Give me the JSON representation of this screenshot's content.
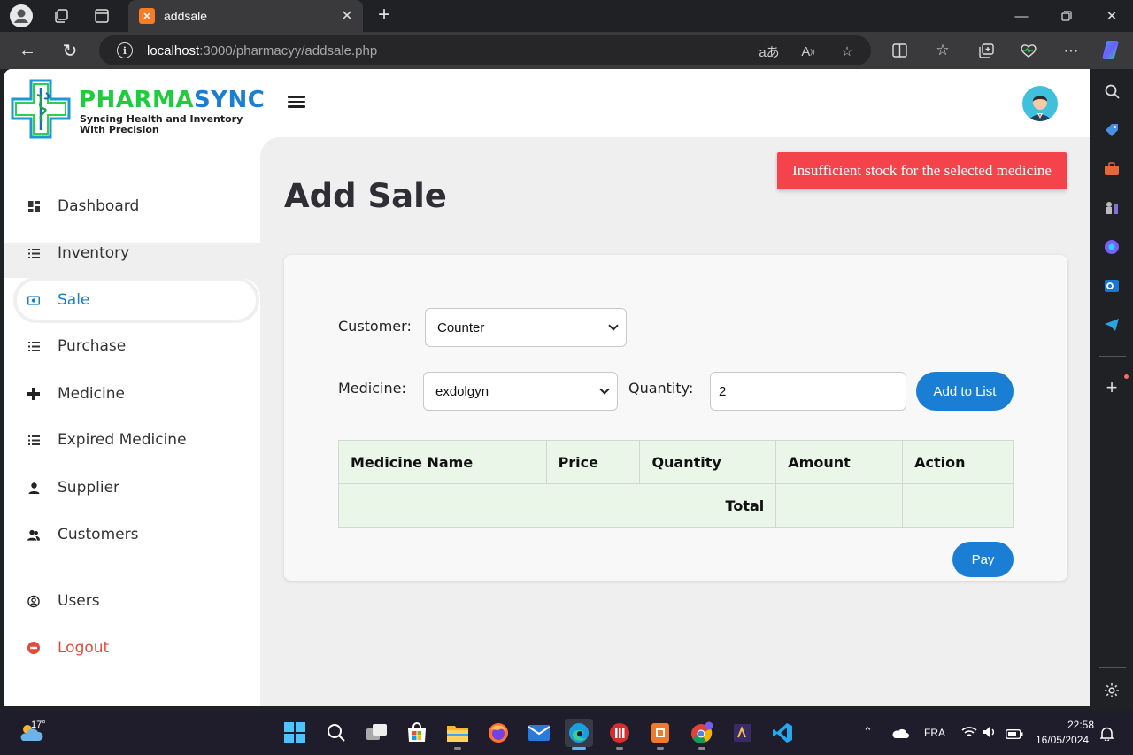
{
  "browser": {
    "tab_title": "addsale",
    "url_host": "localhost",
    "url_rest": ":3000/pharmacyy/addsale.php",
    "accent": "#1a7fd4"
  },
  "app": {
    "brand_left": "PHARMA",
    "brand_right": "SYNC",
    "tagline_1": "Syncing Health and Inventory",
    "tagline_2": "With Precision",
    "brand_green": "#1fcc3c",
    "brand_blue": "#1a7fd4"
  },
  "sidebar": {
    "items": [
      {
        "label": "Dashboard",
        "icon": "dashboard-icon"
      },
      {
        "label": "Inventory",
        "icon": "list-icon"
      },
      {
        "label": "Sale",
        "icon": "money-icon",
        "active": true
      },
      {
        "label": "Purchase",
        "icon": "list-icon"
      },
      {
        "label": "Medicine",
        "icon": "plus-icon"
      },
      {
        "label": "Expired Medicine",
        "icon": "list-icon"
      },
      {
        "label": "Supplier",
        "icon": "person-icon"
      },
      {
        "label": "Customers",
        "icon": "people-icon"
      },
      {
        "label": "Users",
        "icon": "user-circle-icon"
      },
      {
        "label": "Logout",
        "icon": "logout-icon"
      }
    ]
  },
  "alert": {
    "message": "Insufficient stock for the selected medicine",
    "color": "#f4434a"
  },
  "page": {
    "title": "Add Sale"
  },
  "form": {
    "customer_label": "Customer:",
    "customer_value": "Counter",
    "medicine_label": "Medicine:",
    "medicine_value": "exdolgyn",
    "quantity_label": "Quantity:",
    "quantity_value": "2",
    "add_button": "Add to List",
    "pay_button": "Pay"
  },
  "table": {
    "headers": [
      "Medicine Name",
      "Price",
      "Quantity",
      "Amount",
      "Action"
    ],
    "total_label": "Total"
  },
  "taskbar": {
    "temperature": "17°",
    "language": "FRA",
    "time": "22:58",
    "date": "16/05/2024"
  }
}
